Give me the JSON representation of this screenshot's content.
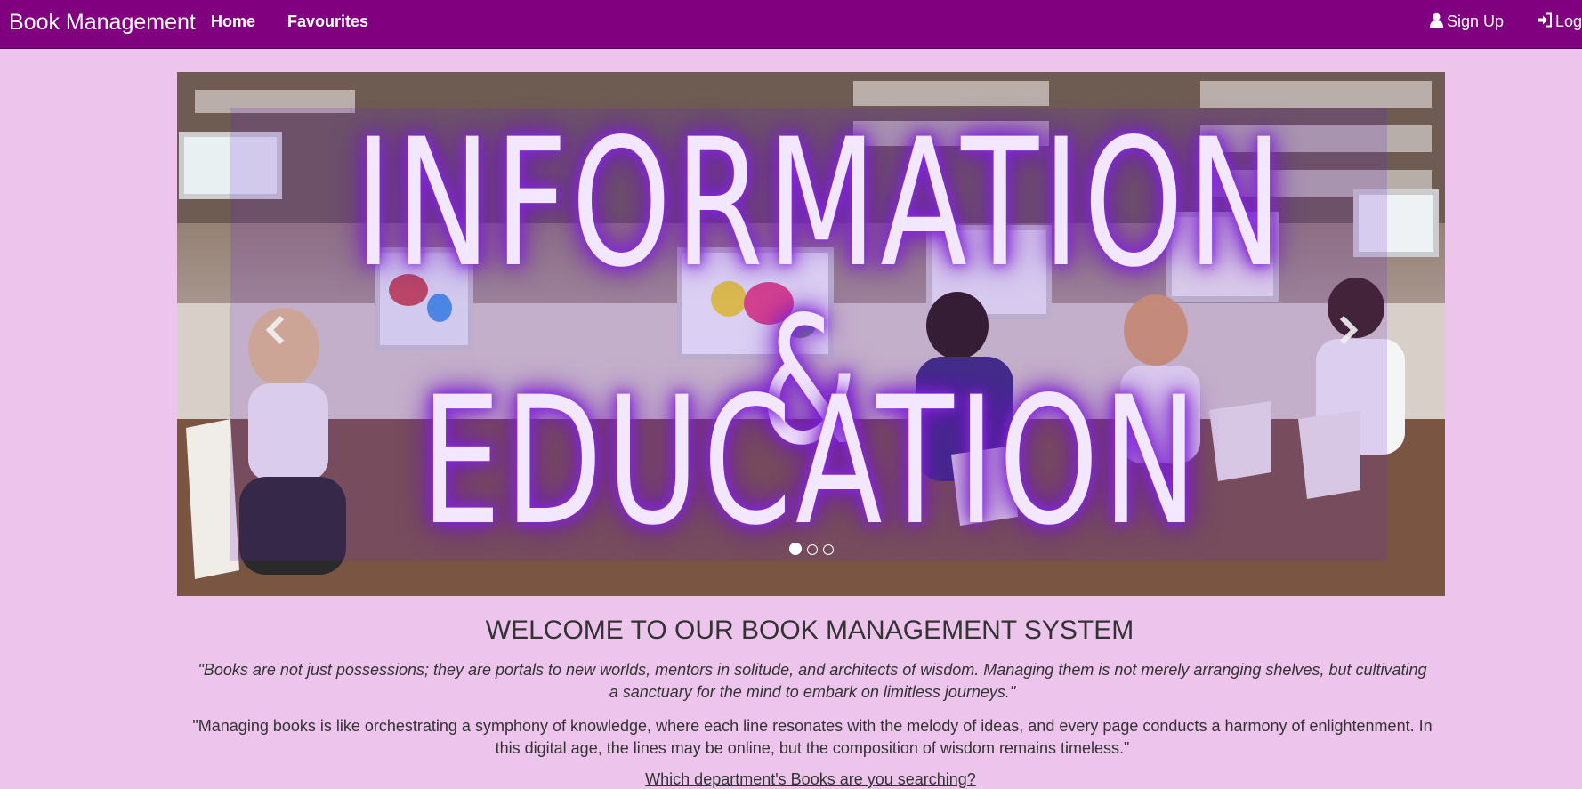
{
  "navbar": {
    "brand": "Book Management",
    "links": [
      "Home",
      "Favourites"
    ],
    "signup": "Sign Up",
    "login": "Login"
  },
  "carousel": {
    "headline_line1": "INFORMATION &",
    "headline_line2": "EDUCATION",
    "slide_count": 3,
    "active_slide": 1
  },
  "welcome": {
    "title": "WELCOME TO OUR BOOK MANAGEMENT SYSTEM",
    "quote1": "\"Books are not just possessions; they are portals to new worlds, mentors in solitude, and architects of wisdom. Managing them is not merely arranging shelves, but cultivating a sanctuary for the mind to embark on limitless journeys.\"",
    "quote2": "\"Managing books is like orchestrating a symphony of knowledge, where each line resonates with the melody of ideas, and every page conducts a harmony of enlightenment. In this digital age, the lines may be online, but the composition of wisdom remains timeless.\"",
    "question": "Which department's Books are you searching?"
  },
  "colors": {
    "navbar": "#800080",
    "background": "#ecc4ec",
    "glow": "#8a2be2"
  },
  "icons": [
    "user-icon",
    "login-icon",
    "chevron-left-icon",
    "chevron-right-icon"
  ]
}
